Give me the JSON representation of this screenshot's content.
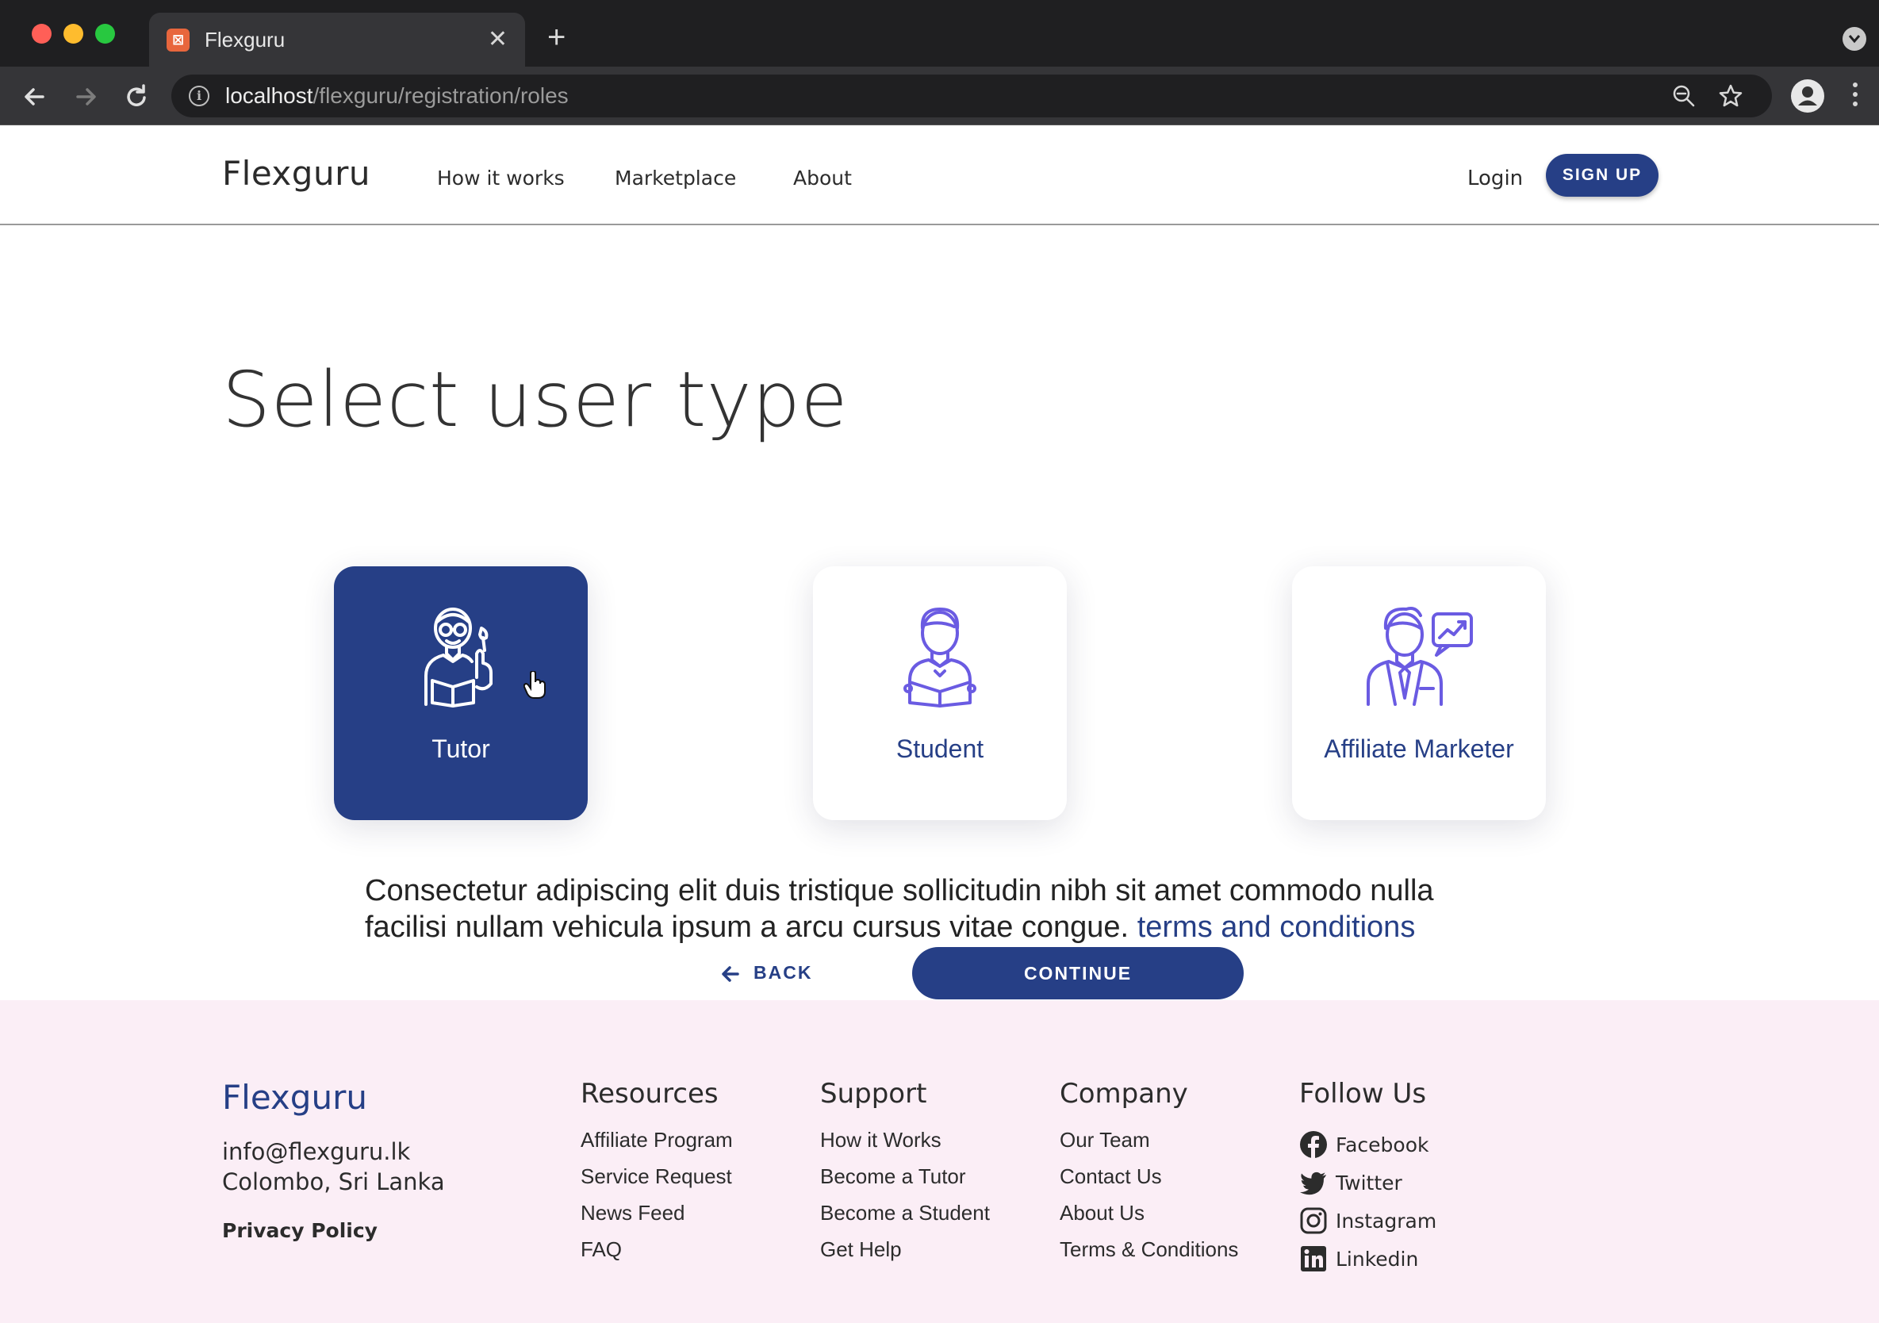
{
  "browser": {
    "tab_title": "Flexguru",
    "url_host": "localhost",
    "url_path": "/flexguru/registration/roles"
  },
  "header": {
    "logo": "Flexguru",
    "nav": [
      "How it works",
      "Marketplace",
      "About"
    ],
    "login": "Login",
    "signup": "SIGN UP"
  },
  "main": {
    "title": "Select user type",
    "roles": [
      {
        "label": "Tutor",
        "icon": "tutor-icon",
        "selected": true
      },
      {
        "label": "Student",
        "icon": "student-icon",
        "selected": false
      },
      {
        "label": "Affiliate Marketer",
        "icon": "affiliate-marketer-icon",
        "selected": false
      }
    ],
    "terms_text": "Consectetur adipiscing elit duis tristique sollicitudin nibh sit amet commodo nulla facilisi nullam vehicula ipsum a arcu cursus vitae congue.",
    "terms_link": "terms and conditions",
    "back": "BACK",
    "continue": "CONTINUE"
  },
  "footer": {
    "logo": "Flexguru",
    "email": "info@flexguru.lk",
    "location": "Colombo, Sri Lanka",
    "privacy": "Privacy Policy",
    "columns": [
      {
        "heading": "Resources",
        "links": [
          "Affiliate Program",
          "Service Request",
          "News Feed",
          "FAQ"
        ]
      },
      {
        "heading": "Support",
        "links": [
          "How it Works",
          "Become a Tutor",
          "Become a Student",
          "Get Help"
        ]
      },
      {
        "heading": "Company",
        "links": [
          "Our Team",
          "Contact Us",
          "About Us",
          "Terms & Conditions"
        ]
      }
    ],
    "follow_heading": "Follow Us",
    "social": [
      {
        "label": "Facebook",
        "icon": "facebook-icon"
      },
      {
        "label": "Twitter",
        "icon": "twitter-icon"
      },
      {
        "label": "Instagram",
        "icon": "instagram-icon"
      },
      {
        "label": "Linkedin",
        "icon": "linkedin-icon"
      }
    ]
  },
  "colors": {
    "primary": "#263f86",
    "icon_purple": "#6a5be2",
    "footer_bg": "#fbeef6"
  }
}
